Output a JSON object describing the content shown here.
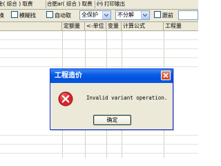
{
  "tabs": [
    {
      "label": "金( 综合 ) 取费"
    },
    {
      "label": "合肥ar( 综合 ) 取费"
    },
    {
      "label": "打印输出"
    }
  ],
  "toolbar": {
    "item_cut": "换",
    "fuzzy_search": "模糊找",
    "auto_fetch": "自动取",
    "protect_select": "全保护",
    "decompose_select": "不分解",
    "follow_label": "跟前"
  },
  "grid": {
    "columns": [
      "定额量",
      "<-单位",
      "变量",
      "计算公式",
      "工程量"
    ]
  },
  "dialog": {
    "title": "工程造价",
    "message": "Invalid variant operation.",
    "ok_label": "确定"
  },
  "colors": {
    "title_blue": "#0a5ce8",
    "error_red": "#d8262b"
  }
}
